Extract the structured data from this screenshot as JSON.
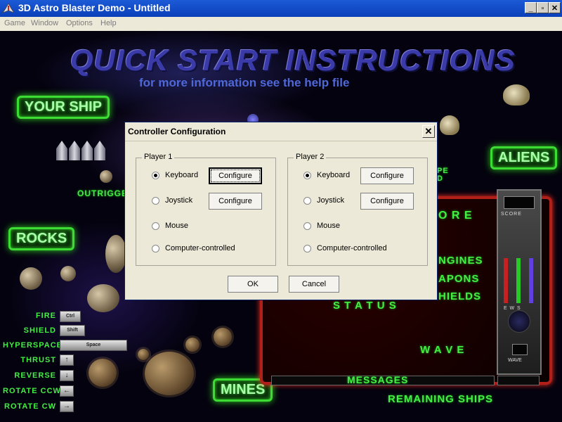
{
  "window": {
    "title": "3D Astro Blaster Demo - Untitled",
    "controls": [
      "_",
      "▫",
      "✕"
    ]
  },
  "menubar": {
    "items": [
      "Game",
      "Window",
      "Options",
      "Help"
    ]
  },
  "scene": {
    "headline": "QUICK START INSTRUCTIONS",
    "subline": "for more information see the help file",
    "badges": {
      "your_ship": "YOUR SHIP",
      "aliens": "ALIENS",
      "rocks": "ROCKS",
      "mines": "MINES"
    },
    "outrigger_label": "OUTRIGGE",
    "partial_right_label": "PE\nD",
    "controls": [
      {
        "label": "FIRE",
        "key": "Ctrl"
      },
      {
        "label": "SHIELD",
        "key": "Shift"
      },
      {
        "label": "HYPERSPACE",
        "key": "Space"
      },
      {
        "label": "THRUST",
        "key": "↑"
      },
      {
        "label": "REVERSE",
        "key": "↓"
      },
      {
        "label": "ROTATE CCW",
        "key": "←"
      },
      {
        "label": "ROTATE CW",
        "key": "→"
      }
    ],
    "panel": {
      "score": "O R E",
      "score_caption": "SCORE",
      "engines": "NGINES",
      "weapons": "APONS",
      "shields": "HIELDS",
      "meter_caption": "E  W  S",
      "status": "S T A T U S",
      "wave": "W A V E",
      "wave_caption": "WAVE",
      "messages": "MESSAGES",
      "remaining": "REMAINING SHIPS"
    },
    "colors": {
      "green": "#44ee44",
      "panel_red": "#b02018"
    }
  },
  "dialog": {
    "title": "Controller Configuration",
    "close": "✕",
    "player1": {
      "label": "Player 1",
      "options": [
        "Keyboard",
        "Joystick",
        "Mouse",
        "Computer-controlled"
      ],
      "selected": "Keyboard",
      "configure_labels": [
        "Configure",
        "Configure"
      ]
    },
    "player2": {
      "label": "Player 2",
      "options": [
        "Keyboard",
        "Joystick",
        "Mouse",
        "Computer-controlled"
      ],
      "selected": "Keyboard",
      "configure_labels": [
        "Configure",
        "Configure"
      ]
    },
    "ok": "OK",
    "cancel": "Cancel"
  }
}
